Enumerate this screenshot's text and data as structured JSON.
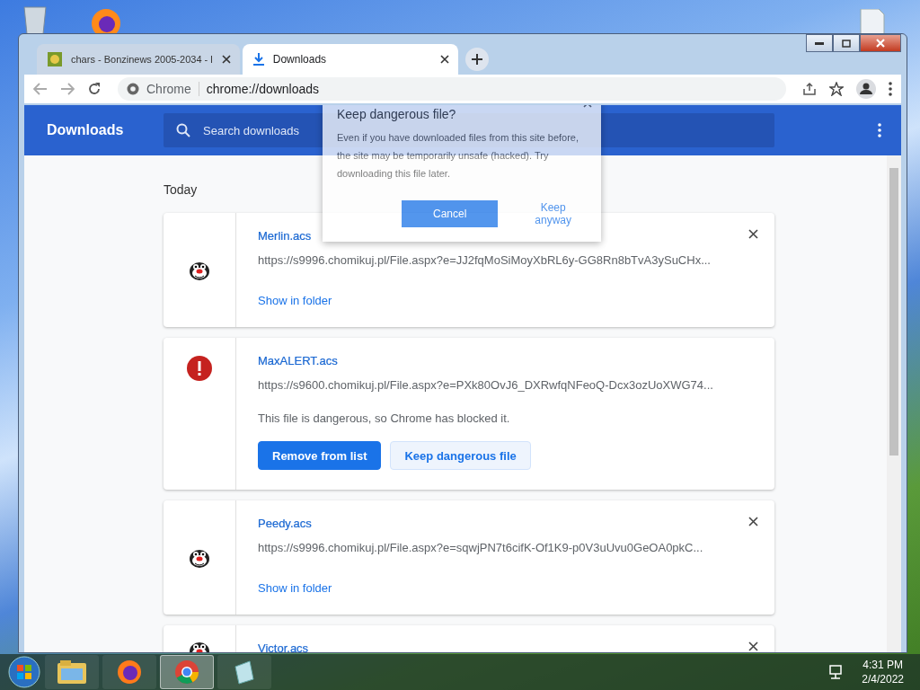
{
  "tabs": [
    {
      "title": "chars - Bonzinews 2005-2034 - l",
      "kind": "site",
      "selected": false
    },
    {
      "title": "Downloads",
      "kind": "download",
      "selected": true
    }
  ],
  "omnibox": {
    "chip": "Chrome",
    "url": "chrome://downloads"
  },
  "header": {
    "title": "Downloads",
    "search_placeholder": "Search downloads"
  },
  "section": "Today",
  "downloads": [
    {
      "name": "Merlin.acs",
      "url": "https://s9996.chomikuj.pl/File.aspx?e=JJ2fqMoSiMoyXbRL6y-GG8Rn8bTvA3ySuCHx...",
      "kind": "done",
      "action": "Show in folder"
    },
    {
      "name": "MaxALERT.acs",
      "url": "https://s9600.chomikuj.pl/File.aspx?e=PXk80OvJ6_DXRwfqNFeoQ-Dcx3ozUoXWG74...",
      "kind": "dangerous",
      "warning": "This file is dangerous, so Chrome has blocked it.",
      "buttons": [
        "Remove from list",
        "Keep dangerous file"
      ]
    },
    {
      "name": "Peedy.acs",
      "url": "https://s9996.chomikuj.pl/File.aspx?e=sqwjPN7t6cifK-Of1K9-p0V3uUvu0GeOA0pkC...",
      "kind": "done",
      "action": "Show in folder"
    },
    {
      "name": "Victor.acs",
      "kind": "done"
    }
  ],
  "dialog": {
    "title": "Keep dangerous file?",
    "body": "Even if you have downloaded files from this site before, the site may be temporarily unsafe (hacked). Try downloading this file later.",
    "buttons": [
      "Cancel",
      "Keep anyway"
    ]
  },
  "taskbar": [
    {
      "kind": "explorer",
      "selected": false
    },
    {
      "kind": "firefox",
      "selected": false
    },
    {
      "kind": "chrome",
      "selected": true
    },
    {
      "kind": "notepad",
      "selected": false
    }
  ],
  "clock": {
    "time": "4:31 PM",
    "date": "2/4/2022"
  }
}
